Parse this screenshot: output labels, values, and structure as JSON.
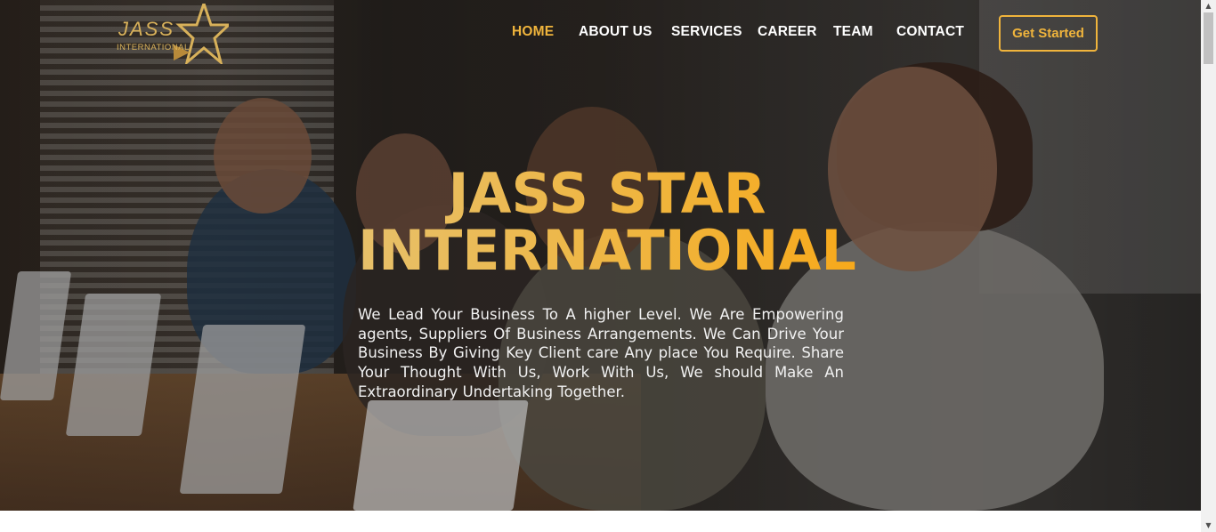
{
  "brand": {
    "logo_main": "JASS",
    "logo_sub": "INTERNATIONAL",
    "accent_color": "#f0b43c"
  },
  "nav": {
    "items": [
      {
        "label": "HOME",
        "active": true
      },
      {
        "label": "ABOUT US",
        "active": false
      },
      {
        "label": "SERVICES",
        "active": false
      },
      {
        "label": "CAREER",
        "active": false
      },
      {
        "label": "TEAM",
        "active": false
      },
      {
        "label": "CONTACT",
        "active": false
      }
    ],
    "cta_label": "Get Started"
  },
  "hero": {
    "title_line1": "JASS STAR",
    "title_line2": "INTERNATIONAL.",
    "description": "We Lead Your Business To A higher Level. We Are Empowering agents, Suppliers Of Business Arrangements. We Can Drive Your Business By Giving Key Client care Any place You Require. Share Your Thought With Us, Work With Us, We should Make An Extraordinary Undertaking Together.",
    "background": "call-center-agents-with-headsets-photo"
  },
  "scrollbar": {
    "up_icon": "chevron-up-icon",
    "down_icon": "chevron-down-icon"
  }
}
